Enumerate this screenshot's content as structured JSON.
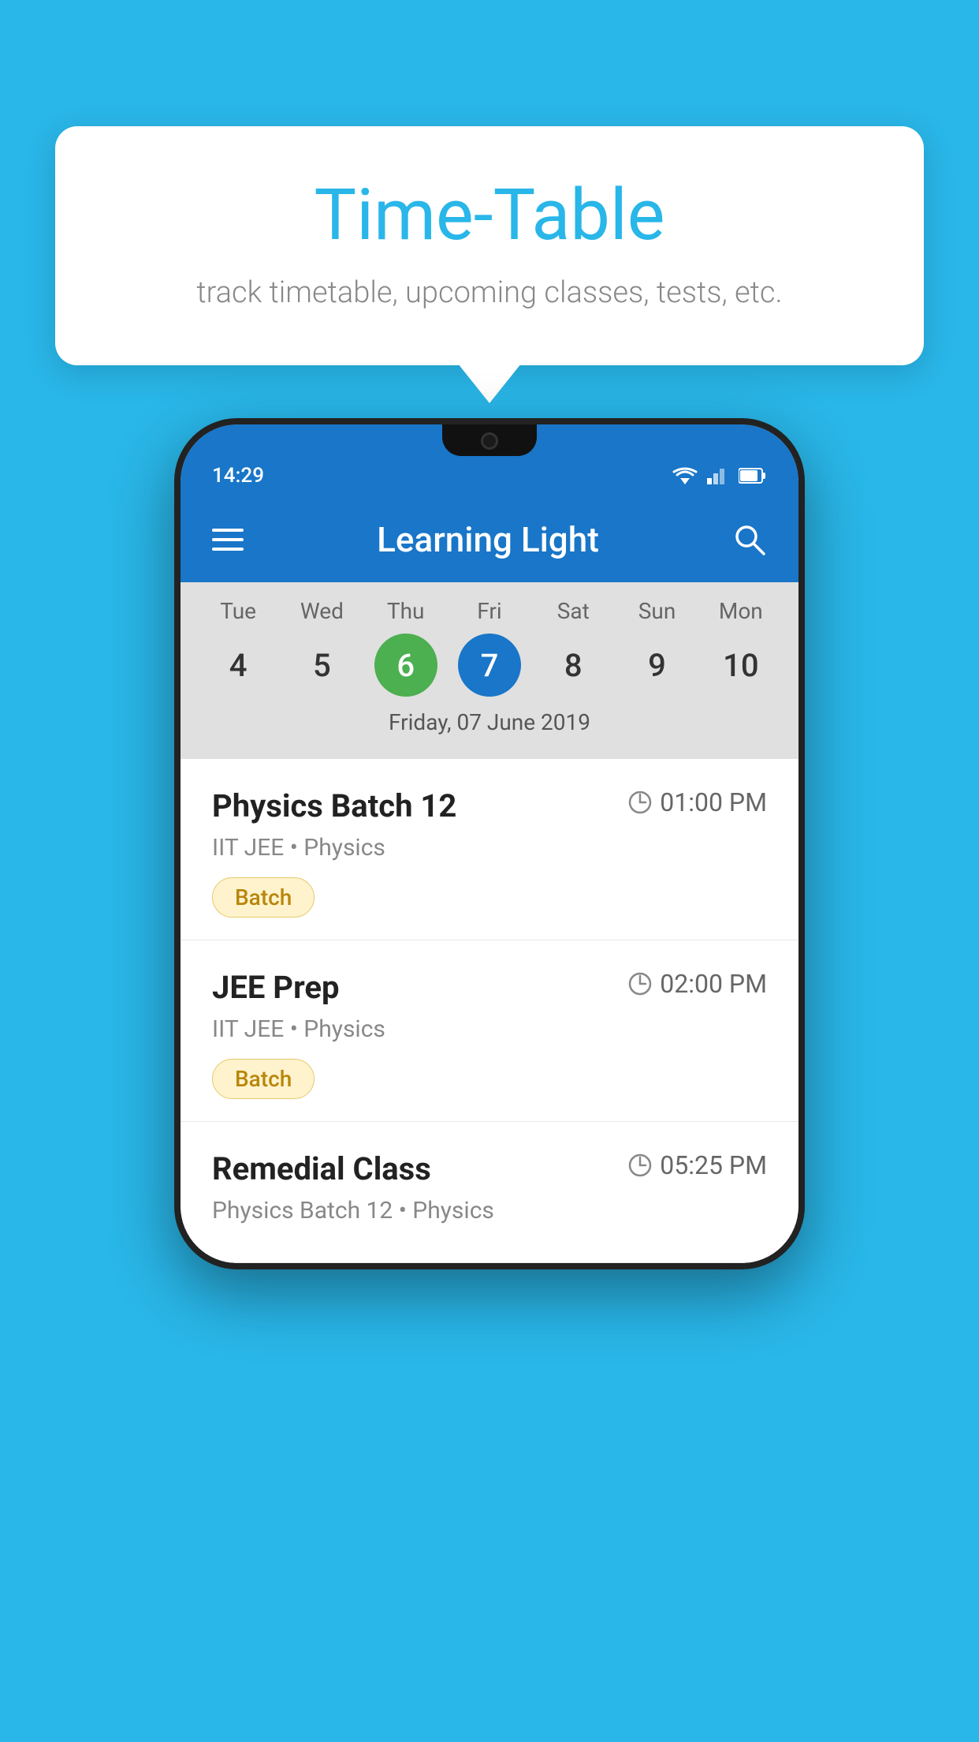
{
  "background_color": "#29b6e8",
  "tooltip": {
    "title": "Time-Table",
    "subtitle": "track timetable, upcoming classes, tests, etc."
  },
  "app": {
    "name": "Learning Light",
    "status_time": "14:29"
  },
  "calendar": {
    "days": [
      {
        "name": "Tue",
        "number": "4",
        "state": "normal"
      },
      {
        "name": "Wed",
        "number": "5",
        "state": "normal"
      },
      {
        "name": "Thu",
        "number": "6",
        "state": "today"
      },
      {
        "name": "Fri",
        "number": "7",
        "state": "selected"
      },
      {
        "name": "Sat",
        "number": "8",
        "state": "normal"
      },
      {
        "name": "Sun",
        "number": "9",
        "state": "normal"
      },
      {
        "name": "Mon",
        "number": "10",
        "state": "normal"
      }
    ],
    "selected_date_label": "Friday, 07 June 2019"
  },
  "classes": [
    {
      "name": "Physics Batch 12",
      "time": "01:00 PM",
      "meta": "IIT JEE • Physics",
      "badge": "Batch"
    },
    {
      "name": "JEE Prep",
      "time": "02:00 PM",
      "meta": "IIT JEE • Physics",
      "badge": "Batch"
    },
    {
      "name": "Remedial Class",
      "time": "05:25 PM",
      "meta": "Physics Batch 12 • Physics",
      "badge": null
    }
  ]
}
